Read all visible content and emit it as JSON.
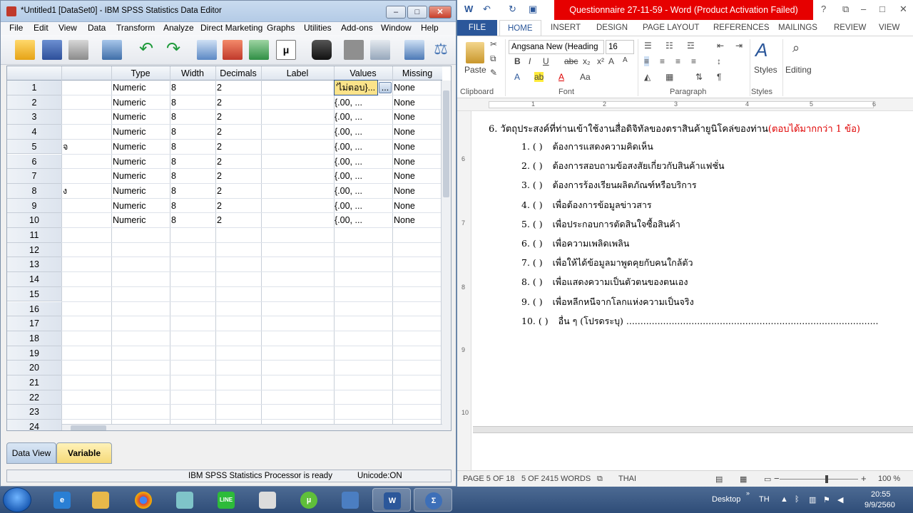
{
  "spss": {
    "title": "*Untitled1 [DataSet0] - IBM SPSS Statistics Data Editor",
    "menu": [
      "File",
      "Edit",
      "View",
      "Data",
      "Transform",
      "Analyze",
      "Direct Marketing",
      "Graphs",
      "Utilities",
      "Add-ons",
      "Window",
      "Help"
    ],
    "columns": [
      "Type",
      "Width",
      "Decimals",
      "Label",
      "Values",
      "Missing"
    ],
    "rows": [
      {
        "num": "1",
        "name": "",
        "type": "Numeric",
        "width": "8",
        "decimals": "2",
        "values": "'ไม่ตอบ}...",
        "missing": "None"
      },
      {
        "num": "2",
        "name": "",
        "type": "Numeric",
        "width": "8",
        "decimals": "2",
        "values": "{.00, ...",
        "missing": "None"
      },
      {
        "num": "3",
        "name": "",
        "type": "Numeric",
        "width": "8",
        "decimals": "2",
        "values": "{.00, ...",
        "missing": "None"
      },
      {
        "num": "4",
        "name": "",
        "type": "Numeric",
        "width": "8",
        "decimals": "2",
        "values": "{.00, ...",
        "missing": "None"
      },
      {
        "num": "5",
        "name": "จ",
        "type": "Numeric",
        "width": "8",
        "decimals": "2",
        "values": "{.00, ...",
        "missing": "None"
      },
      {
        "num": "6",
        "name": "",
        "type": "Numeric",
        "width": "8",
        "decimals": "2",
        "values": "{.00, ...",
        "missing": "None"
      },
      {
        "num": "7",
        "name": "",
        "type": "Numeric",
        "width": "8",
        "decimals": "2",
        "values": "{.00, ...",
        "missing": "None"
      },
      {
        "num": "8",
        "name": "ง",
        "type": "Numeric",
        "width": "8",
        "decimals": "2",
        "values": "{.00, ...",
        "missing": "None"
      },
      {
        "num": "9",
        "name": "",
        "type": "Numeric",
        "width": "8",
        "decimals": "2",
        "values": "{.00, ...",
        "missing": "None"
      },
      {
        "num": "10",
        "name": "",
        "type": "Numeric",
        "width": "8",
        "decimals": "2",
        "values": "{.00, ...",
        "missing": "None"
      }
    ],
    "empty_rows": [
      "11",
      "12",
      "13",
      "14",
      "15",
      "16",
      "17",
      "18",
      "19",
      "20",
      "21",
      "22",
      "23",
      "24"
    ],
    "values_button": "...",
    "tabs": {
      "data_view": "Data View",
      "variable_view": "Variable View"
    },
    "status": {
      "processor": "IBM SPSS Statistics Processor is ready",
      "unicode": "Unicode:ON"
    }
  },
  "word": {
    "title": "Questionnaire 27-11-59 - Word (Product Activation Failed)",
    "tabs": [
      "FILE",
      "HOME",
      "INSERT",
      "DESIGN",
      "PAGE LAYOUT",
      "REFERENCES",
      "MAILINGS",
      "REVIEW",
      "VIEW"
    ],
    "ribbon": {
      "paste": "Paste",
      "font_name": "Angsana New (Heading",
      "font_size": "16",
      "styles": "Styles",
      "editing": "Editing",
      "groups": {
        "clipboard": "Clipboard",
        "font": "Font",
        "paragraph": "Paragraph",
        "styles": "Styles"
      }
    },
    "ruler_ticks": [
      "1",
      "2",
      "3",
      "4",
      "5",
      "6"
    ],
    "vruler_ticks": [
      "6",
      "7",
      "8",
      "9",
      "10"
    ],
    "document": {
      "question": "6. วัตถุประสงค์ที่ท่านเข้าใช้งานสื่อดิจิทัลของตราสินค้ายูนิโคล่ของท่าน",
      "question_hint": "(ตอบได้มากกว่า 1 ข้อ)",
      "options": [
        {
          "num": "1. (     )",
          "text": "ต้องการแสดงความคิดเห็น"
        },
        {
          "num": "2. (     )",
          "text": "ต้องการสอบถามข้อสงสัยเกี่ยวกับสินค้าแฟชั่น"
        },
        {
          "num": "3. (     )",
          "text": "ต้องการร้องเรียนผลิตภัณฑ์หรือบริการ"
        },
        {
          "num": "4. (     )",
          "text": "เพื่อต้องการข้อมูลข่าวสาร"
        },
        {
          "num": "5. (     )",
          "text": "เพื่อประกอบการตัดสินใจซื้อสินค้า"
        },
        {
          "num": "6. (     )",
          "text": "เพื่อความเพลิดเพลิน"
        },
        {
          "num": "7. (     )",
          "text": "เพื่อให้ได้ข้อมูลมาพูดคุยกับคนใกล้ตัว"
        },
        {
          "num": "8. (     )",
          "text": "เพื่อแสดงความเป็นตัวตนของตนเอง"
        },
        {
          "num": "9. (     )",
          "text": "เพื่อหลีกหนีจากโลกแห่งความเป็นจริง"
        },
        {
          "num": "10. (     )",
          "text": "อื่น ๆ (โปรดระบุ) ........................................................................................."
        }
      ]
    },
    "status": {
      "page": "PAGE 5 OF 18",
      "words": "5 OF 2415 WORDS",
      "lang": "THAI",
      "zoom": "100 %"
    }
  },
  "taskbar": {
    "desktop": "Desktop",
    "lang": "TH",
    "time": "20:55",
    "date": "9/9/2560"
  }
}
